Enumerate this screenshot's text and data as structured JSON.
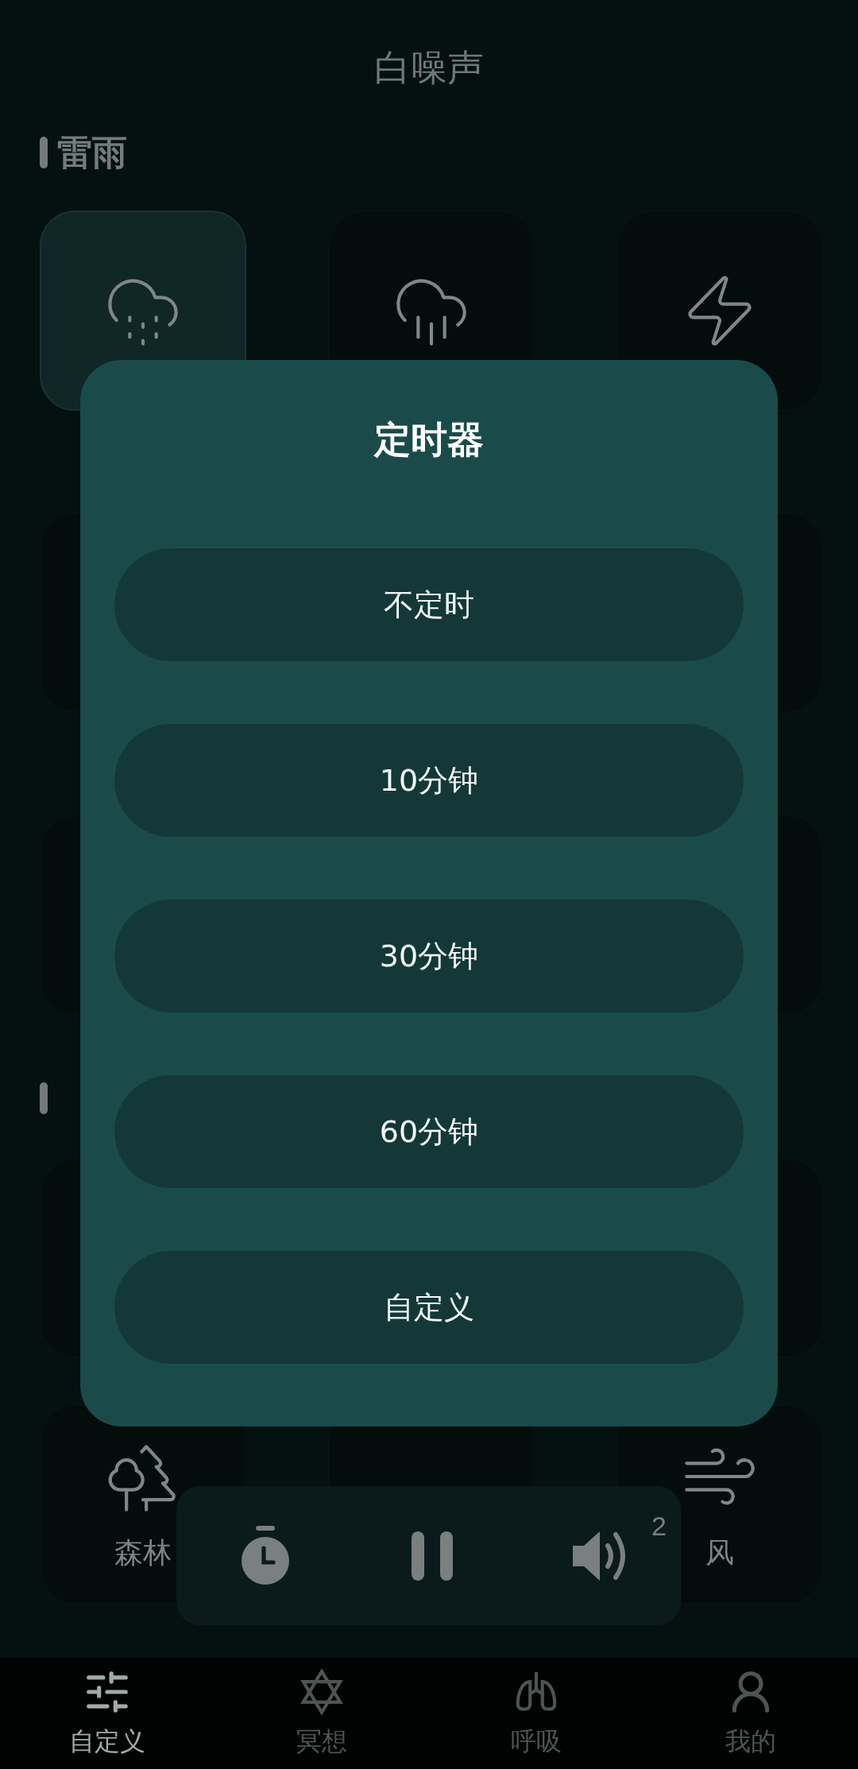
{
  "title": "白噪声",
  "sections": [
    {
      "heading": "雷雨",
      "tiles": [
        {
          "kind": "light-rain",
          "selected": true
        },
        {
          "kind": "heavy-rain",
          "selected": false
        },
        {
          "kind": "thunder",
          "selected": false
        },
        {
          "kind": "blank",
          "selected": false
        },
        {
          "kind": "blank"
        },
        {
          "kind": "blank",
          "selected": false
        },
        {
          "kind": "blank",
          "selected": false
        },
        {
          "kind": "blank"
        },
        {
          "kind": "blank",
          "selected": false
        }
      ]
    },
    {
      "tiles": [
        {
          "kind": "blank",
          "selected": false
        },
        {
          "kind": "blank"
        },
        {
          "kind": "blank",
          "selected": false
        },
        {
          "kind": "forest",
          "label": "森林",
          "selected": false
        },
        {
          "kind": "blank",
          "selected": false
        },
        {
          "kind": "wind",
          "label": "风",
          "selected": false
        }
      ]
    }
  ],
  "player": {
    "volume_badge": "2"
  },
  "dialog": {
    "title": "定时器",
    "options": [
      "不定时",
      "10分钟",
      "30分钟",
      "60分钟",
      "自定义"
    ]
  },
  "nav": [
    {
      "label": "自定义",
      "kind": "sliders",
      "selected": true
    },
    {
      "label": "冥想",
      "kind": "hexagram",
      "selected": false
    },
    {
      "label": "呼吸",
      "kind": "lungs",
      "selected": false
    },
    {
      "label": "我的",
      "kind": "user",
      "selected": false
    }
  ]
}
